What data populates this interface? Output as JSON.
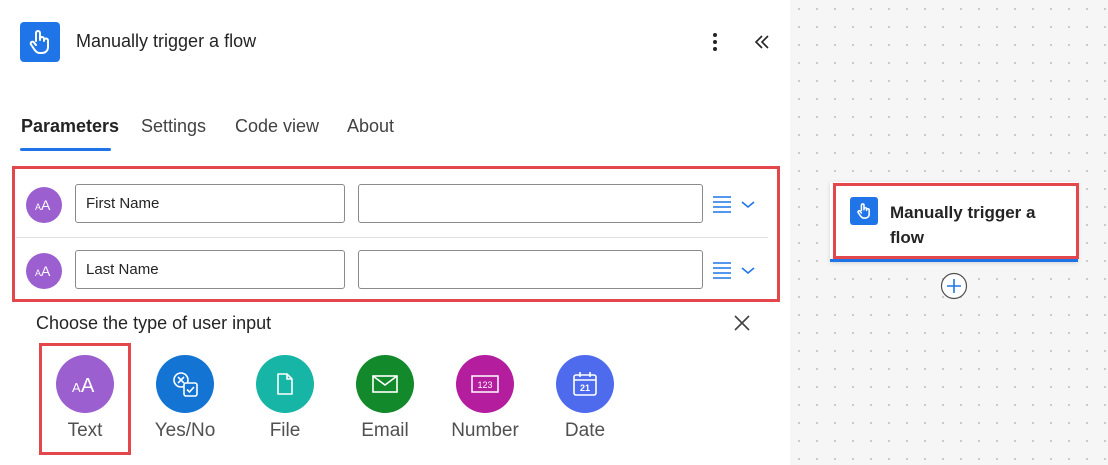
{
  "header": {
    "title": "Manually trigger a flow",
    "icon": "touch-trigger-icon",
    "accent": "#1f75e8"
  },
  "tabs": [
    {
      "label": "Parameters",
      "active": true
    },
    {
      "label": "Settings",
      "active": false
    },
    {
      "label": "Code view",
      "active": false
    },
    {
      "label": "About",
      "active": false
    }
  ],
  "inputs": [
    {
      "name": "First Name",
      "value": "",
      "icon": "text-input-icon"
    },
    {
      "name": "Last Name",
      "value": "",
      "icon": "text-input-icon"
    }
  ],
  "chooser": {
    "title": "Choose the type of user input",
    "options": [
      {
        "label": "Text",
        "color": "#9c5fd0",
        "icon": "text-type-icon"
      },
      {
        "label": "Yes/No",
        "color": "#1474d4",
        "icon": "yes-no-icon"
      },
      {
        "label": "File",
        "color": "#17b5a6",
        "icon": "file-icon"
      },
      {
        "label": "Email",
        "color": "#128a2b",
        "icon": "email-icon"
      },
      {
        "label": "Number",
        "color": "#b41d9e",
        "icon": "number-icon"
      },
      {
        "label": "Date",
        "color": "#4f6bed",
        "icon": "calendar-icon"
      }
    ]
  },
  "canvas": {
    "card_title": "Manually trigger a flow"
  },
  "highlight_color": "#e3474b"
}
